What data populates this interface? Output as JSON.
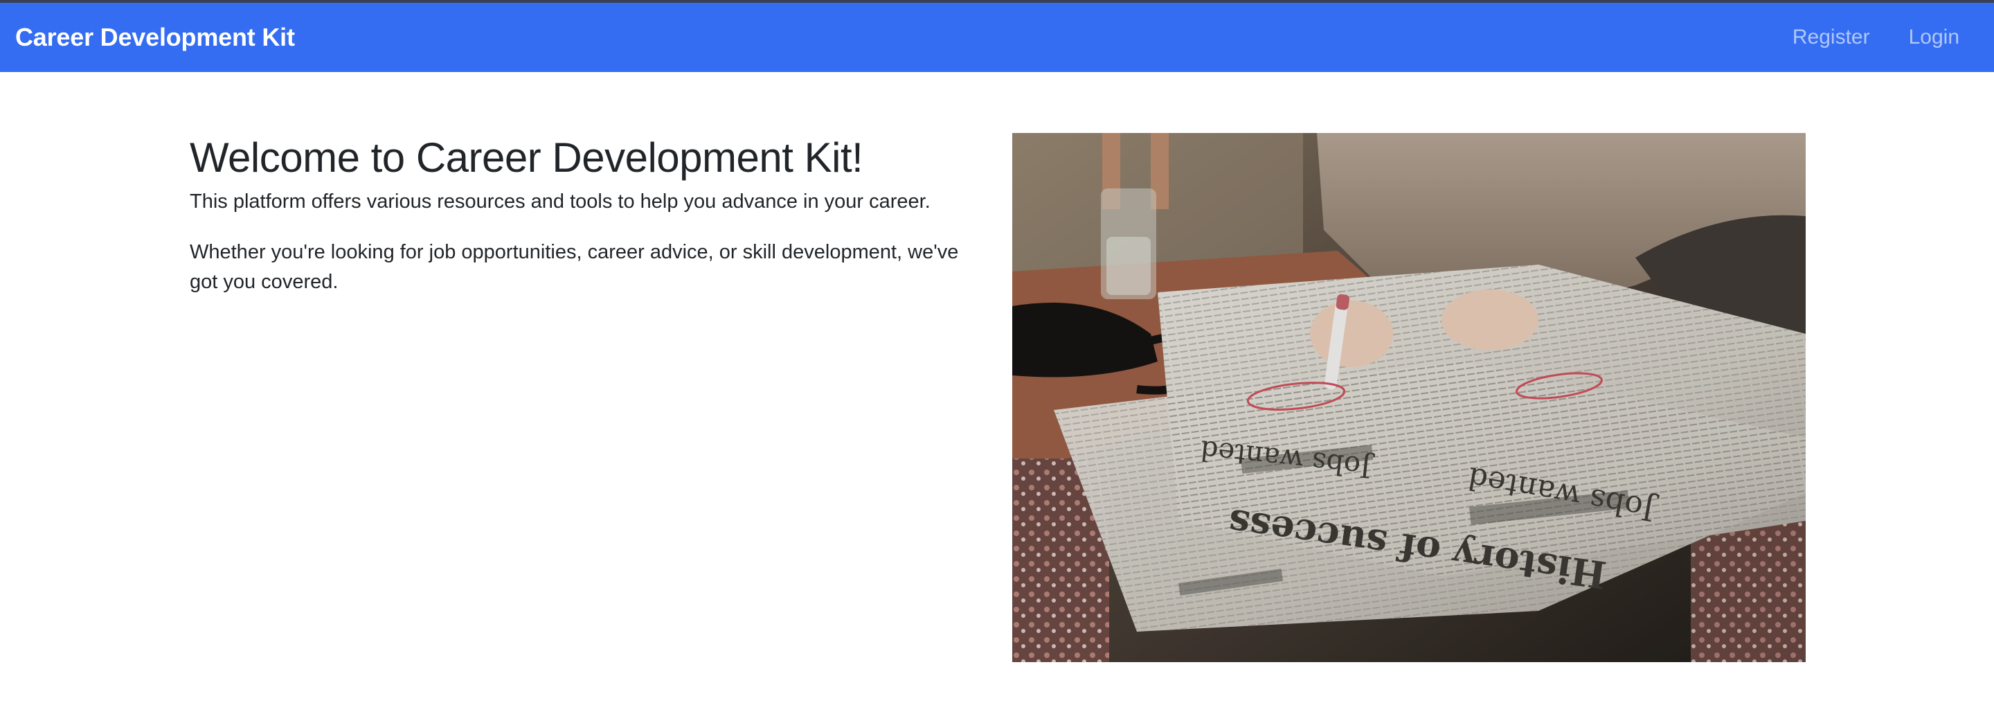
{
  "navbar": {
    "brand": "Career Development Kit",
    "links": [
      {
        "label": "Register"
      },
      {
        "label": "Login"
      }
    ]
  },
  "main": {
    "heading": "Welcome to Career Development Kit!",
    "paragraphs": [
      "This platform offers various resources and tools to help you advance in your career.",
      "Whether you're looking for job opportunities, career advice, or skill development, we've got you covered."
    ],
    "image": {
      "newspaper_headlines": [
        "Jobs wanted",
        "History of success",
        "Jobs wanted"
      ]
    }
  },
  "colors": {
    "navbar": "#346df1",
    "topline": "#3a3f52",
    "text": "#212529"
  }
}
